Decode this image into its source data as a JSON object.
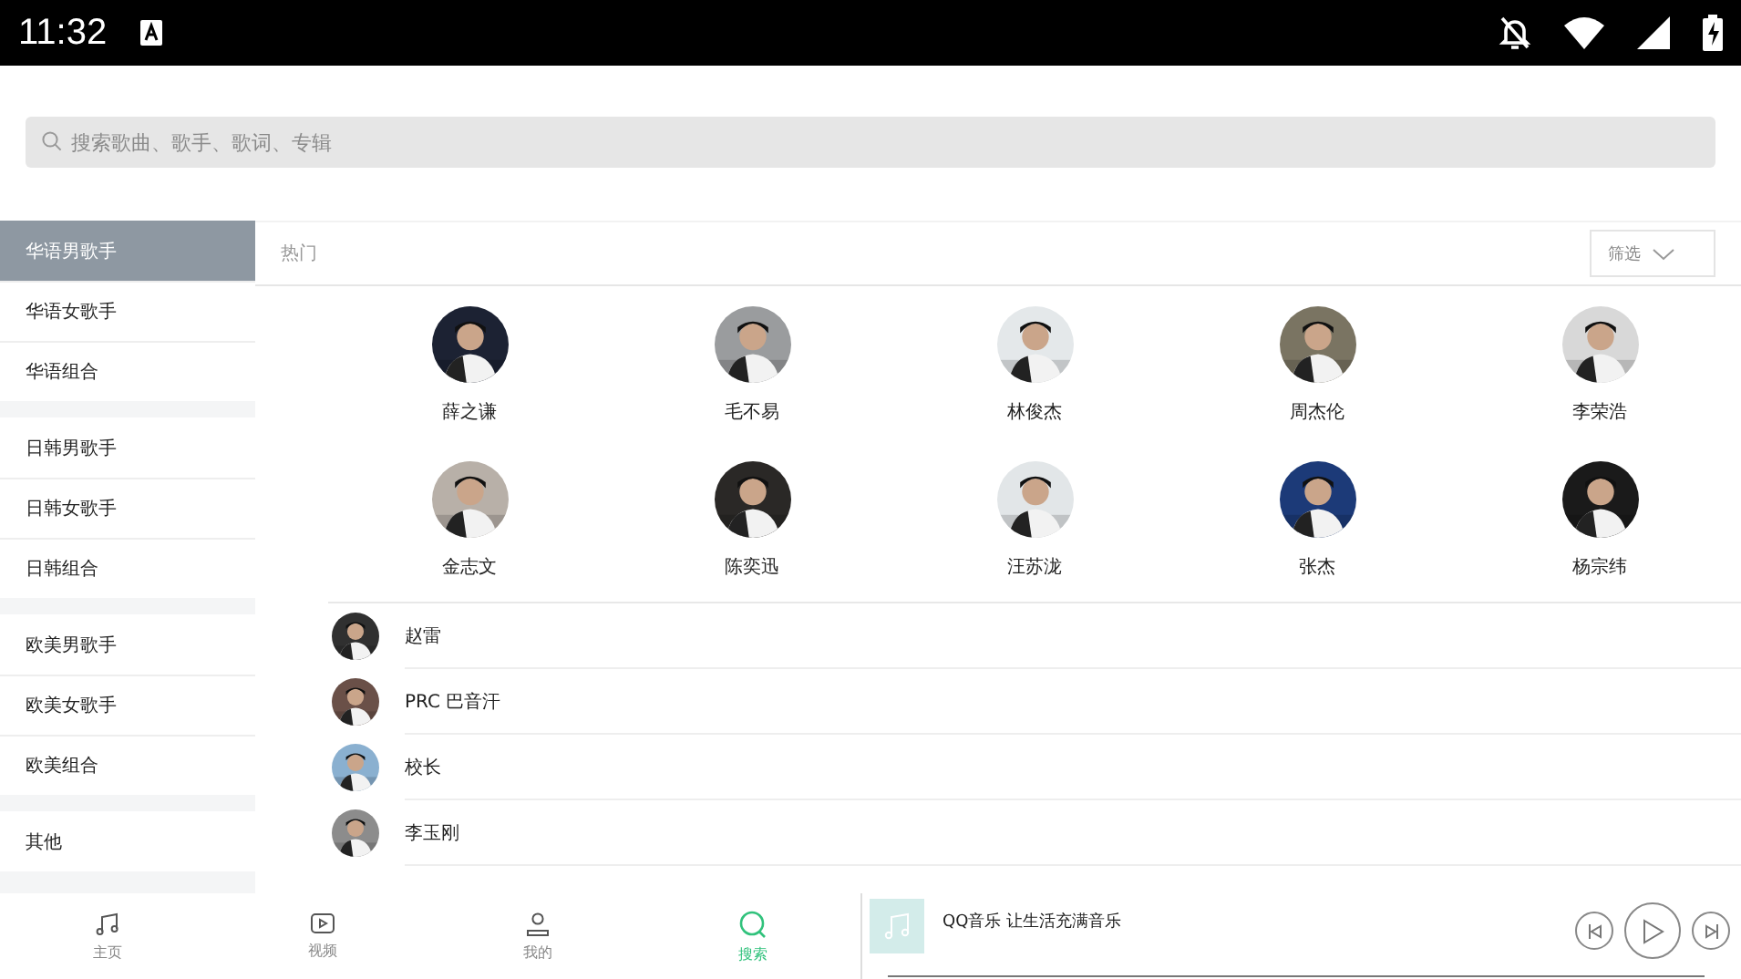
{
  "status_bar": {
    "time": "11:32"
  },
  "search": {
    "placeholder": "搜索歌曲、歌手、歌词、专辑"
  },
  "categories": [
    [
      {
        "label": "华语男歌手",
        "selected": true
      },
      {
        "label": "华语女歌手",
        "selected": false
      },
      {
        "label": "华语组合",
        "selected": false
      }
    ],
    [
      {
        "label": "日韩男歌手",
        "selected": false
      },
      {
        "label": "日韩女歌手",
        "selected": false
      },
      {
        "label": "日韩组合",
        "selected": false
      }
    ],
    [
      {
        "label": "欧美男歌手",
        "selected": false
      },
      {
        "label": "欧美女歌手",
        "selected": false
      },
      {
        "label": "欧美组合",
        "selected": false
      }
    ],
    [
      {
        "label": "其他",
        "selected": false
      }
    ]
  ],
  "section_title": "热门",
  "filter_button": "筛选",
  "featured_singers": [
    {
      "name": "薛之谦",
      "color": "#1c2233"
    },
    {
      "name": "毛不易",
      "color": "#9a9c9e"
    },
    {
      "name": "林俊杰",
      "color": "#e4e8ea"
    },
    {
      "name": "周杰伦",
      "color": "#7a7462"
    },
    {
      "name": "李荣浩",
      "color": "#d8d8d8"
    },
    {
      "name": "金志文",
      "color": "#b8b0a8"
    },
    {
      "name": "陈奕迅",
      "color": "#2a2826"
    },
    {
      "name": "汪苏泷",
      "color": "#e2e6e8"
    },
    {
      "name": "张杰",
      "color": "#1c3a78"
    },
    {
      "name": "杨宗纬",
      "color": "#1a1a1a"
    }
  ],
  "singer_list": [
    {
      "name": "赵雷",
      "color": "#303030"
    },
    {
      "name": "PRC 巴音汗",
      "color": "#6a5048"
    },
    {
      "name": "校长",
      "color": "#8ab0d0"
    },
    {
      "name": "李玉刚",
      "color": "#8c8c8c"
    }
  ],
  "tabs": [
    {
      "label": "主页",
      "kind": "music",
      "selected": false
    },
    {
      "label": "视频",
      "kind": "video",
      "selected": false
    },
    {
      "label": "我的",
      "kind": "person",
      "selected": false
    },
    {
      "label": "搜索",
      "kind": "search",
      "selected": true
    }
  ],
  "player": {
    "title": "QQ音乐 让生活充满音乐"
  }
}
